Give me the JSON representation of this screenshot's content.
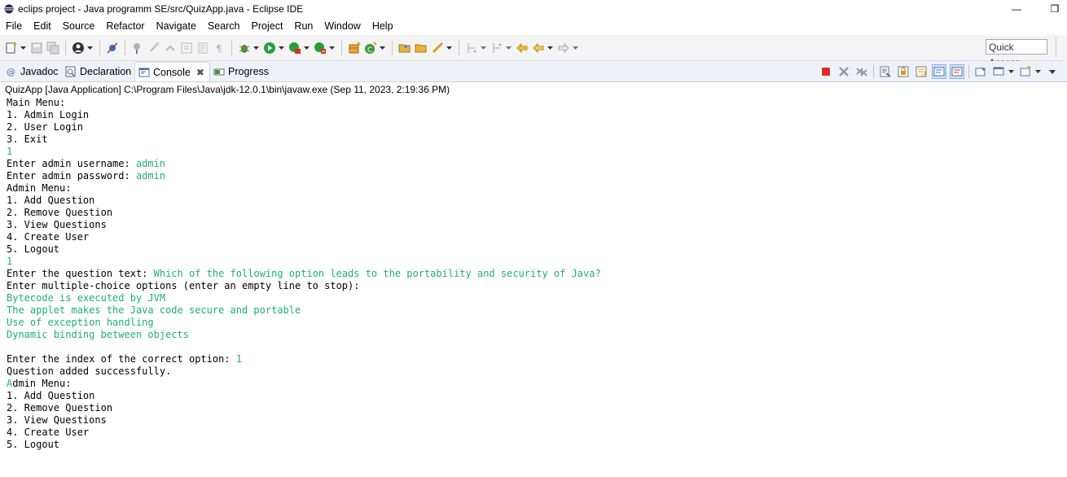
{
  "window": {
    "title": "eclips project - Java programm SE/src/QuizApp.java - Eclipse IDE",
    "minimize_glyph": "—",
    "restore_glyph": "❒"
  },
  "menu": [
    "File",
    "Edit",
    "Source",
    "Refactor",
    "Navigate",
    "Search",
    "Project",
    "Run",
    "Window",
    "Help"
  ],
  "toolbar": {
    "quick_access": "Quick Access"
  },
  "tabs": [
    {
      "label": "Javadoc",
      "icon": "at-icon"
    },
    {
      "label": "Declaration",
      "icon": "declaration-icon"
    },
    {
      "label": "Console",
      "icon": "console-icon",
      "active": true,
      "close": "✖"
    },
    {
      "label": "Progress",
      "icon": "progress-icon"
    }
  ],
  "console": {
    "header": "QuizApp [Java Application] C:\\Program Files\\Java\\jdk-12.0.1\\bin\\javaw.exe (Sep 11, 2023, 2:19:36 PM)",
    "lines": [
      {
        "out": "Main Menu:"
      },
      {
        "out": "1. Admin Login"
      },
      {
        "out": "2. User Login"
      },
      {
        "out": "3. Exit"
      },
      {
        "in": "1"
      },
      {
        "out": "Enter admin username: ",
        "in": "admin"
      },
      {
        "out": "Enter admin password: ",
        "in": "admin"
      },
      {
        "out": "Admin Menu:"
      },
      {
        "out": "1. Add Question"
      },
      {
        "out": "2. Remove Question"
      },
      {
        "out": "3. View Questions"
      },
      {
        "out": "4. Create User"
      },
      {
        "out": "5. Logout"
      },
      {
        "in": "1"
      },
      {
        "out": "Enter the question text: ",
        "in": "Which of the following option leads to the portability and security of Java?"
      },
      {
        "out": "Enter multiple-choice options (enter an empty line to stop):"
      },
      {
        "in": "Bytecode is executed by JVM"
      },
      {
        "in": "The applet makes the Java code secure and portable"
      },
      {
        "in": "Use of exception handling"
      },
      {
        "in": "Dynamic binding between objects"
      },
      {
        "out": ""
      },
      {
        "out": "Enter the index of the correct option: ",
        "in": "1"
      },
      {
        "out": "Question added successfully."
      },
      {
        "in": "A",
        "out_after": "dmin Menu:"
      },
      {
        "out": "1. Add Question"
      },
      {
        "out": "2. Remove Question"
      },
      {
        "out": "3. View Questions"
      },
      {
        "out": "4. Create User"
      },
      {
        "out": "5. Logout"
      }
    ]
  },
  "colors": {
    "stdin": "#20b070",
    "tab_strip": "#eef2f8",
    "toolbar": "#f4f4f4",
    "terminate_red": "#d9302c"
  }
}
